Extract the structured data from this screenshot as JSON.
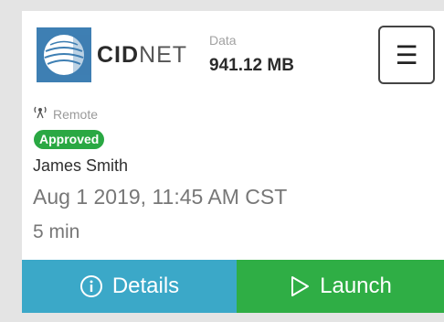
{
  "header": {
    "brand_strong": "CID",
    "brand_light": "NET",
    "data_label": "Data",
    "data_value": "941.12 MB",
    "menu_icon": "menu-icon"
  },
  "session": {
    "type_icon": "remote-icon",
    "type_label": "Remote",
    "status": "Approved",
    "user": "James Smith",
    "datetime": "Aug 1 2019, 11:45 AM CST",
    "duration": "5 min"
  },
  "actions": {
    "details_label": "Details",
    "details_icon": "info-icon",
    "launch_label": "Launch",
    "launch_icon": "play-icon"
  },
  "colors": {
    "logo": "#3e7fb3",
    "approved_badge": "#2aa843",
    "details_button": "#3ba8c8",
    "launch_button": "#2fae45"
  }
}
